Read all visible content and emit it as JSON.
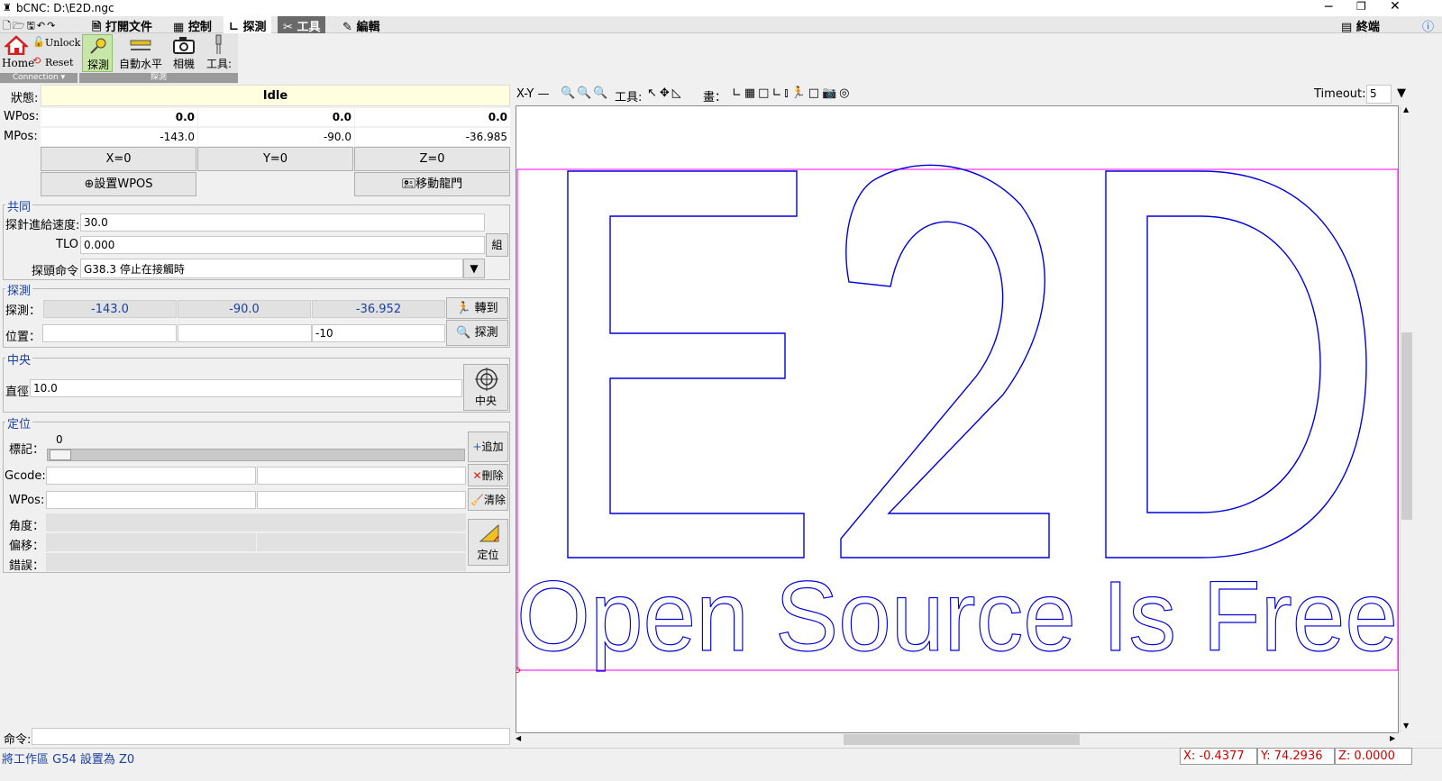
{
  "window": {
    "title": "bCNC: D:\\E2D.ngc"
  },
  "menubar": {
    "tabs": [
      {
        "label": "打開文件"
      },
      {
        "label": "控制"
      },
      {
        "label": "探測"
      },
      {
        "label": "工具"
      },
      {
        "label": "編輯"
      }
    ],
    "right_label": "終端"
  },
  "ribbon": {
    "home": "Home",
    "unlock": "Unlock",
    "reset": "Reset",
    "connection": "Connection",
    "probe": "探測",
    "autolevel": "自動水平",
    "camera": "相機",
    "tool": "工具:",
    "probe_group": "探測"
  },
  "state": {
    "status_label": "狀態:",
    "status_value": "Idle",
    "wpos_label": "WPos:",
    "wpos": [
      "0.0",
      "0.0",
      "0.0"
    ],
    "mpos_label": "MPos:",
    "mpos": [
      "-143.0",
      "-90.0",
      "-36.985"
    ],
    "zero_buttons": [
      "X=0",
      "Y=0",
      "Z=0"
    ],
    "set_wpos": "設置WPOS",
    "move_gantry": "移動龍門"
  },
  "common": {
    "title": "共同",
    "feed_label": "探針進給速度:",
    "feed_value": "30.0",
    "tlo_label": "TLO",
    "tlo_value": "0.000",
    "set_button": "組",
    "cmd_label": "探頭命令",
    "cmd_value": "G38.3 停止在接觸時"
  },
  "probe": {
    "title": "探測",
    "probe_label": "探測：",
    "probe_values": [
      "-143.0",
      "-90.0",
      "-36.952"
    ],
    "goto_button": "轉到",
    "pos_label": "位置：",
    "pos_values": [
      "",
      "",
      "-10"
    ],
    "probe_button": "探測"
  },
  "center": {
    "title": "中央",
    "diameter_label": "直徑",
    "diameter_value": "10.0",
    "center_button": "中央"
  },
  "orient": {
    "title": "定位",
    "marker_label": "標記：",
    "marker_value": "0",
    "add_button": "追加",
    "gcode_label": "Gcode:",
    "delete_button": "刪除",
    "wpos_label": "WPos:",
    "clear_button": "清除",
    "angle_label": "角度：",
    "offset_label": "偏移：",
    "error_label": "錯誤：",
    "orient_button": "定位"
  },
  "command": {
    "label": "命令:",
    "value": ""
  },
  "statusbar": {
    "message": "將工作區 G54 設置為 Z0",
    "x": "X: -0.4377",
    "y": "Y: 74.2936",
    "z": "Z: 0.0000"
  },
  "canvas_toolbar": {
    "view": "X-Y",
    "tools_label": "工具:",
    "draw_label": "畫：",
    "timeout_label": "Timeout:",
    "timeout_value": "5"
  },
  "canvas": {
    "path_color": "#0000dd",
    "margin_color": "#ff00ff",
    "tagline": "Open Source Is Free"
  }
}
